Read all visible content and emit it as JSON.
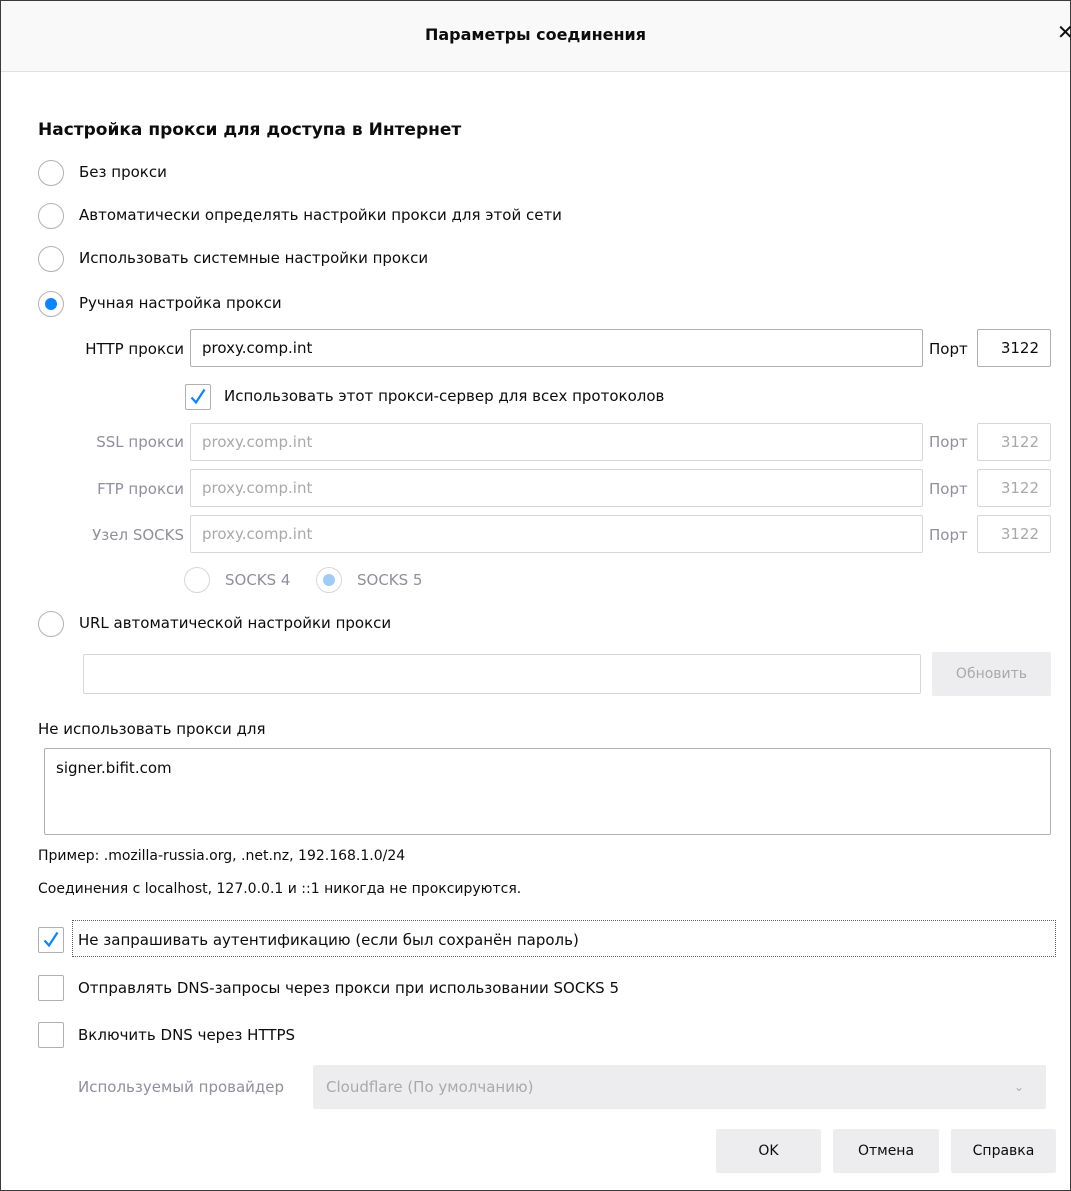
{
  "window": {
    "title": "Параметры соединения",
    "close_glyph": "✕"
  },
  "section_title": "Настройка прокси для доступа в Интернет",
  "radios": {
    "no_proxy": "Без прокси",
    "auto_detect": "Автоматически определять настройки прокси для этой сети",
    "system": "Использовать системные настройки прокси",
    "manual": "Ручная настройка прокси",
    "pac_url": "URL автоматической настройки прокси"
  },
  "manual": {
    "http_label": "HTTP прокси",
    "http_value": "proxy.comp.int",
    "port_label": "Порт",
    "http_port": "3122",
    "use_for_all": "Использовать этот прокси-сервер для всех протоколов",
    "ssl_label": "SSL прокси",
    "ssl_value": "proxy.comp.int",
    "ssl_port": "3122",
    "ftp_label": "FTP прокси",
    "ftp_value": "proxy.comp.int",
    "ftp_port": "3122",
    "socks_label": "Узел SOCKS",
    "socks_value": "proxy.comp.int",
    "socks_port": "3122",
    "socks4": "SOCKS 4",
    "socks5": "SOCKS 5"
  },
  "pac": {
    "url_value": "",
    "refresh": "Обновить"
  },
  "no_proxy_for": {
    "label": "Не использовать прокси для",
    "value": "signer.bifit.com",
    "example": "Пример: .mozilla-russia.org, .net.nz, 192.168.1.0/24",
    "localhost_note": "Соединения с localhost, 127.0.0.1 и ::1 никогда не проксируются."
  },
  "checks": {
    "no_auth_prompt": "Не запрашивать аутентификацию (если был сохранён пароль)",
    "socks_dns": "Отправлять DNS-запросы через прокси при использовании SOCKS 5",
    "doh": "Включить DNS через HTTPS"
  },
  "doh": {
    "provider_label": "Используемый провайдер",
    "provider_value": "Cloudflare (По умолчанию)"
  },
  "buttons": {
    "ok": "OK",
    "cancel": "Отмена",
    "help": "Справка"
  },
  "colors": {
    "accent": "#0a84ff",
    "button_bg": "#ededf0",
    "border": "#b1b1b3"
  }
}
